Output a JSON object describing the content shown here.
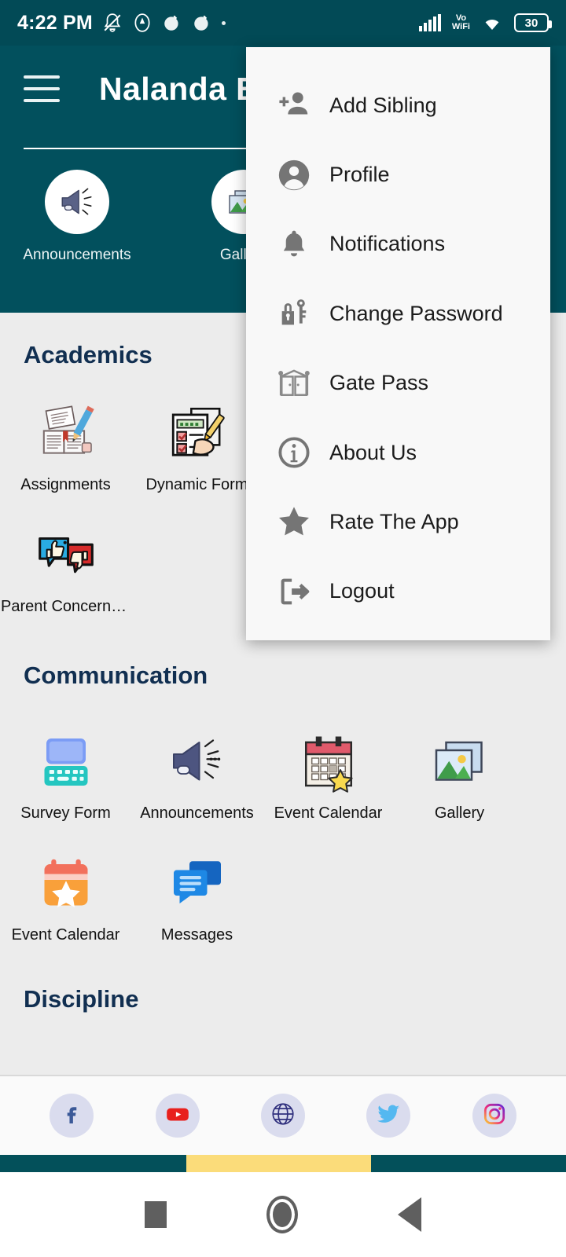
{
  "statusbar": {
    "time": "4:22 PM",
    "battery_level": "30",
    "network_label": "Vo\nWiFi",
    "icons": [
      "mute-bell-icon",
      "app-notification-icon-1",
      "app-notification-icon-2",
      "app-notification-icon-3",
      "more-dot-icon",
      "signal-icon",
      "vowifi-icon",
      "wifi-icon",
      "battery-icon"
    ]
  },
  "header": {
    "menu_icon": "hamburger-menu-icon",
    "title": "Nalanda E",
    "shortcuts": [
      {
        "label": "Announcements",
        "icon": "megaphone-icon"
      },
      {
        "label": "Gallery",
        "icon": "photos-icon"
      }
    ]
  },
  "sections": [
    {
      "title": "Academics",
      "tiles": [
        {
          "label": "Assignments",
          "icon": "book-pencil-icon"
        },
        {
          "label": "Dynamic Form",
          "icon": "clipboard-hand-icon"
        },
        {
          "label": "Parent Concern F...",
          "icon": "feedback-bubbles-icon"
        }
      ]
    },
    {
      "title": "Communication",
      "tiles": [
        {
          "label": "Survey Form",
          "icon": "survey-laptop-icon"
        },
        {
          "label": "Announcements",
          "icon": "megaphone-icon"
        },
        {
          "label": "Event Calendar",
          "icon": "calendar-red-star-icon"
        },
        {
          "label": "Gallery",
          "icon": "photos-icon"
        },
        {
          "label": "Event Calendar",
          "icon": "calendar-orange-star-icon"
        },
        {
          "label": "Messages",
          "icon": "chat-bubbles-icon"
        }
      ]
    },
    {
      "title": "Discipline",
      "tiles": []
    }
  ],
  "overflow_menu": {
    "items": [
      {
        "label": "Add Sibling",
        "icon": "add-person-icon"
      },
      {
        "label": "Profile",
        "icon": "account-circle-icon"
      },
      {
        "label": "Notifications",
        "icon": "bell-icon"
      },
      {
        "label": "Change Password",
        "icon": "lock-key-icon"
      },
      {
        "label": "Gate Pass",
        "icon": "gate-icon"
      },
      {
        "label": "About Us",
        "icon": "info-circle-icon"
      },
      {
        "label": "Rate The App",
        "icon": "star-icon"
      },
      {
        "label": "Logout",
        "icon": "logout-arrow-icon"
      }
    ]
  },
  "social_bar": {
    "items": [
      {
        "name": "facebook",
        "icon": "facebook-icon"
      },
      {
        "name": "youtube",
        "icon": "youtube-icon"
      },
      {
        "name": "website",
        "icon": "globe-icon"
      },
      {
        "name": "twitter",
        "icon": "twitter-icon"
      },
      {
        "name": "instagram",
        "icon": "instagram-icon"
      }
    ]
  },
  "navbar": {
    "buttons": [
      "recents-button",
      "home-button",
      "back-button"
    ]
  },
  "colors": {
    "header_teal": "#02505d",
    "status_teal": "#024a56",
    "accent_yellow": "#fbdc7a",
    "section_title": "#112f51",
    "page_bg": "#ececec"
  }
}
